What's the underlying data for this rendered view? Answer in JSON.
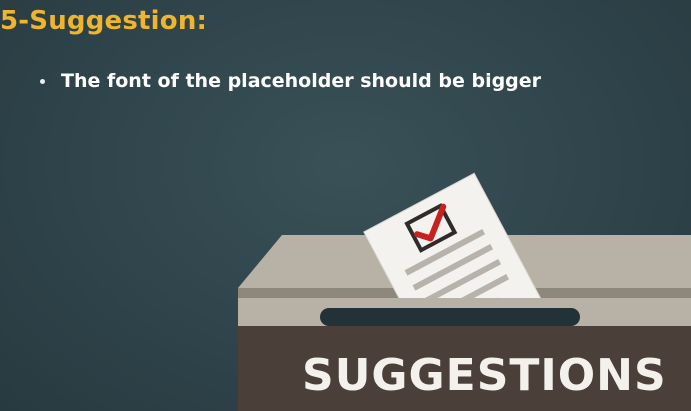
{
  "slide": {
    "title": "5-Suggestion:",
    "bullets": [
      "The font of the placeholder should be bigger"
    ]
  },
  "illustration": {
    "box_label": "SUGGESTIONS",
    "colors": {
      "title": "#f0b52a",
      "background": "#2f444b",
      "box_lid": "#b8b2a6",
      "box_front": "#4b3f3a",
      "slot": "#223236",
      "paper": "#f4f2ee",
      "check": "#c8201e"
    },
    "icons": [
      "checkbox-icon",
      "ballot-box-icon"
    ]
  }
}
